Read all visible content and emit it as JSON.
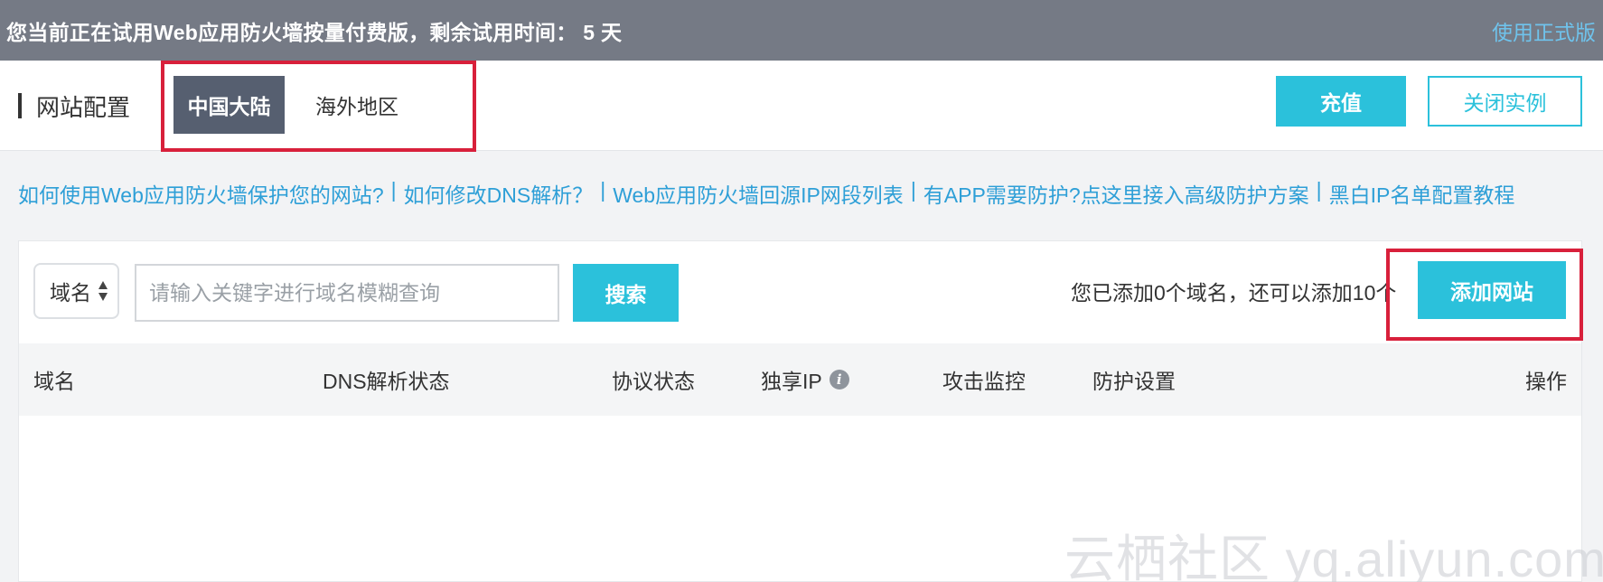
{
  "trial_bar": {
    "message": "您当前正在试用Web应用防火墙按量付费版，剩余试用时间： 5 天",
    "upgrade_link": "使用正式版"
  },
  "header": {
    "title": "网站配置",
    "region_tabs": [
      {
        "label": "中国大陆",
        "active": true
      },
      {
        "label": "海外地区",
        "active": false
      }
    ],
    "recharge_button": "充值",
    "close_instance_button": "关闭实例"
  },
  "help_links": [
    "如何使用Web应用防火墙保护您的网站?",
    "如何修改DNS解析？",
    "Web应用防火墙回源IP网段列表",
    "有APP需要防护?点这里接入高级防护方案",
    "黑白IP名单配置教程"
  ],
  "help_link_separator": "|",
  "toolbar": {
    "filter_select": "域名",
    "search_placeholder": "请输入关键字进行域名模糊查询",
    "search_button": "搜索",
    "domain_count_text": "您已添加0个域名，还可以添加10个",
    "add_site_button": "添加网站"
  },
  "table": {
    "columns": [
      "域名",
      "DNS解析状态",
      "协议状态",
      "独享IP",
      "攻击监控",
      "防护设置",
      "操作"
    ],
    "info_icon_glyph": "i",
    "rows": []
  },
  "watermark": "云栖社区 yq.aliyun.com",
  "colors": {
    "trial_bar": "#757a85",
    "accent": "#2bc1db",
    "active_tab": "#565f70",
    "link": "#2e9fd7",
    "highlight": "#d8203b"
  }
}
